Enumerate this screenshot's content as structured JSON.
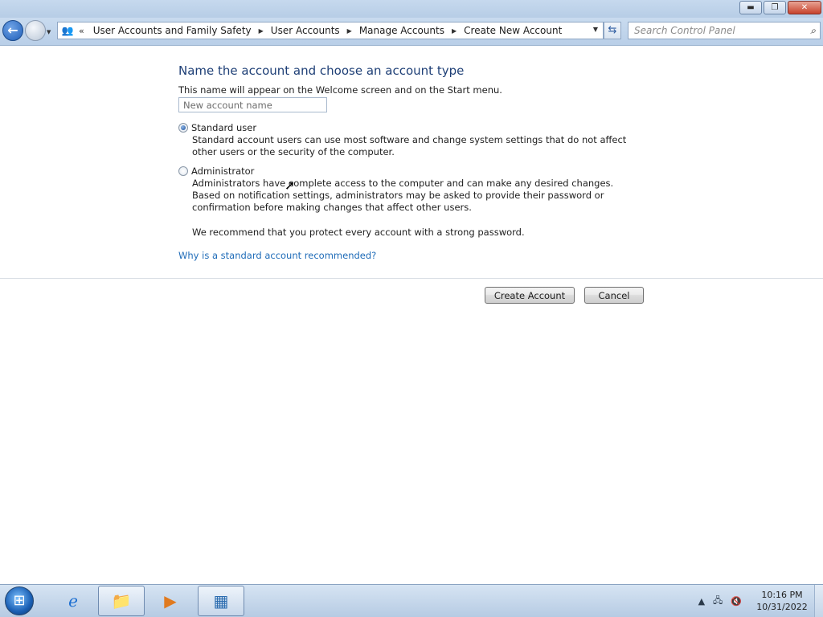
{
  "window": {
    "minimize_icon": "minimize-icon",
    "maximize_icon": "restore-icon",
    "close_icon": "close-icon"
  },
  "nav": {
    "back_icon": "back-arrow-icon",
    "forward_icon": "forward-arrow-icon",
    "breadcrumbs": [
      {
        "label": "User Accounts and Family Safety"
      },
      {
        "label": "User Accounts"
      },
      {
        "label": "Manage Accounts"
      },
      {
        "label": "Create New Account"
      }
    ],
    "search_placeholder": "Search Control Panel"
  },
  "page": {
    "heading": "Name the account and choose an account type",
    "description": "This name will appear on the Welcome screen and on the Start menu.",
    "name_placeholder": "New account name",
    "name_value": "",
    "options": [
      {
        "label": "Standard user",
        "checked": true,
        "description": "Standard account users can use most software and change system settings that do not affect other users or the security of the computer."
      },
      {
        "label": "Administrator",
        "checked": false,
        "description": "Administrators have complete access to the computer and can make any desired changes. Based on notification settings, administrators may be asked to provide their password or confirmation before making changes that affect other users."
      }
    ],
    "recommendation": "We recommend that you protect every account with a strong password.",
    "help_link": "Why is a standard account recommended?",
    "create_button": "Create Account",
    "cancel_button": "Cancel"
  },
  "taskbar": {
    "items": [
      {
        "icon": "internet-explorer-icon"
      },
      {
        "icon": "file-explorer-icon"
      },
      {
        "icon": "media-player-icon"
      },
      {
        "icon": "control-panel-icon"
      }
    ],
    "time": "10:16 PM",
    "date": "10/31/2022"
  }
}
